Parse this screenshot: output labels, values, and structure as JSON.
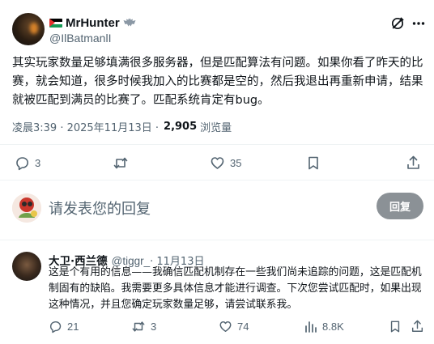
{
  "post": {
    "display_name": "MrHunter",
    "handle": "@IlBatmanlI",
    "text": "其实玩家数量足够填满很多服务器，但是匹配算法有问题。如果你看了昨天的比赛，就会知道，很多时候我加入的比赛都是空的，然后我退出再重新申请，结果就被匹配到满员的比赛了。匹配系统肯定有bug。",
    "time": "凌晨3:39 · 2025年11月13日 · ",
    "views_count": "2,905",
    "views_label": "浏览量",
    "actions": {
      "replies": "3",
      "retweets": "",
      "likes": "35"
    }
  },
  "composer": {
    "placeholder": "请发表您的回复",
    "button_label": "回复"
  },
  "reply": {
    "name": "大卫·西兰德",
    "handle": "@tiggr_",
    "date": " · 11月13日",
    "text": "这是个有用的信息——我确信匹配机制存在一些我们尚未追踪的问题，这是匹配机制固有的缺陷。我需要更多具体信息才能进行调查。下次您尝试匹配时，如果出现这种情况，并且您确定玩家数量足够，请尝试联系我。",
    "actions": {
      "replies": "21",
      "retweets": "3",
      "likes": "74",
      "views": "8.8K"
    }
  },
  "icons": [
    "grok-icon",
    "more-icon",
    "reply-icon",
    "retweet-icon",
    "like-icon",
    "views-icon",
    "bookmark-icon",
    "share-icon"
  ]
}
